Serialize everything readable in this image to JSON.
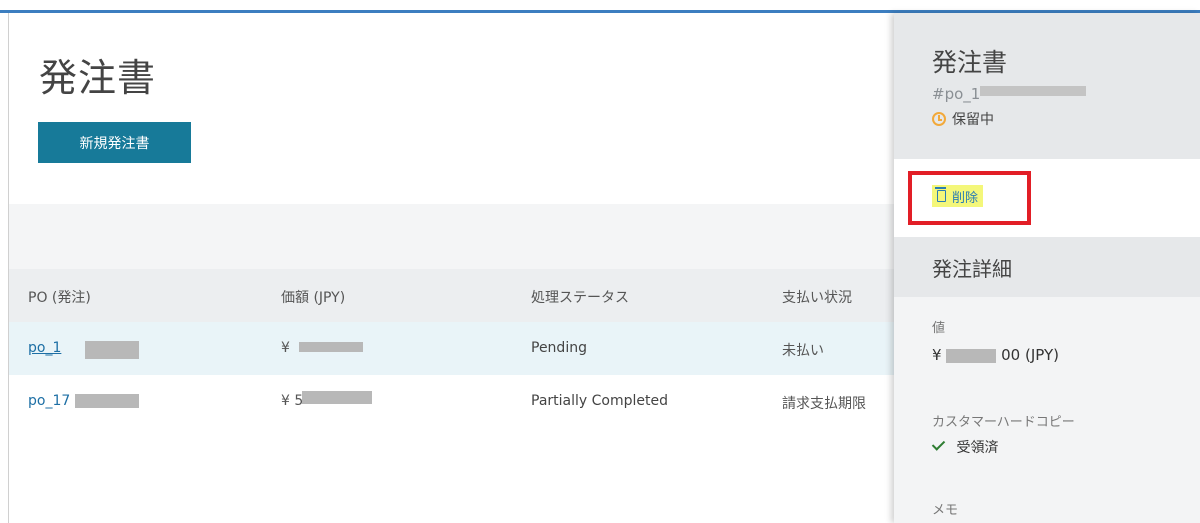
{
  "main": {
    "title": "発注書",
    "new_button": "新規発注書",
    "columns": [
      "PO (発注)",
      "価額 (JPY)",
      "処理ステータス",
      "支払い状況"
    ],
    "rows": [
      {
        "po": "po_1",
        "amount": "¥",
        "status": "Pending",
        "payment": "未払い"
      },
      {
        "po": "po_17",
        "amount": "¥ 5",
        "status": "Partially Completed",
        "payment": "請求支払期限"
      }
    ]
  },
  "panel": {
    "title": "発注書",
    "id": "#po_1",
    "status": "保留中",
    "delete_label": "削除",
    "section_title": "発注詳細",
    "value_label": "値",
    "value_prefix": "¥",
    "value_suffix": "00 (JPY)",
    "hardcopy_label": "カスタマーハードコピー",
    "hardcopy_value": "受領済",
    "memo_label": "メモ"
  },
  "colors": {
    "accent": "#177a99",
    "link": "#1d6fa5",
    "pending": "#f2a93b",
    "highlight_box": "#e21e26",
    "highlight_bg": "#f4f77a"
  }
}
